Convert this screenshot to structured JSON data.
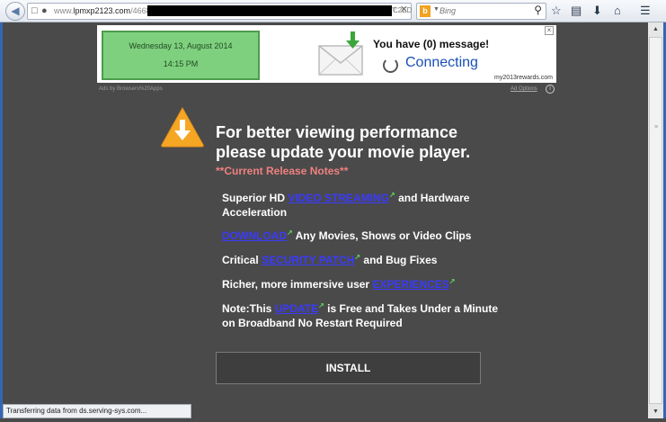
{
  "browser": {
    "url_prefix": "www.",
    "url_domain": "lpmxp2123.com",
    "url_path": "/4668",
    "url_tail": "C2ED",
    "search_placeholder": "Bing",
    "search_logo": "b"
  },
  "ad": {
    "date": "Wednesday 13, August 2014",
    "time": "14:15 PM",
    "message": "You have (0) message!",
    "connecting": "Connecting",
    "domain": "my2013rewards.com",
    "ads_by": "Ads by Browsers%20Apps",
    "ad_options": "Ad Options",
    "close": "×",
    "info": "i"
  },
  "main": {
    "headline": "For better viewing performance please update your movie player.",
    "release_notes": "**Current Release Notes**",
    "f1_a": "Superior HD ",
    "f1_link": "VIDEO STREAMING",
    "f1_b": " and Hardware Acceleration",
    "f2_link": "DOWNLOAD",
    "f2_b": " Any Movies, Shows or Video Clips",
    "f3_a": "Critical ",
    "f3_link": "SECURITY PATCH",
    "f3_b": " and Bug Fixes",
    "f4_a": "Richer, more immersive user ",
    "f4_link": "EXPERIENCES",
    "f5_a": "Note:This ",
    "f5_link": "UPDATE",
    "f5_b": " is Free and Takes Under a Minute on Broadband No Restart Required",
    "install_label": "INSTALL"
  },
  "status": {
    "text": "Transferring data from ds.serving-sys.com..."
  },
  "icons": {
    "back": "back-arrow-icon",
    "bookmark": "star-icon",
    "clipboard": "clipboard-icon",
    "download": "download-arrow-icon",
    "home": "home-icon",
    "menu": "hamburger-menu-icon",
    "warning": "warning-triangle-icon"
  },
  "colors": {
    "page_bg": "#4a4a4a",
    "date_box": "#7ed07e",
    "link": "#3a3aff",
    "release_notes": "#f08080",
    "warning": "#f5a623",
    "connecting": "#1a4fb5"
  }
}
